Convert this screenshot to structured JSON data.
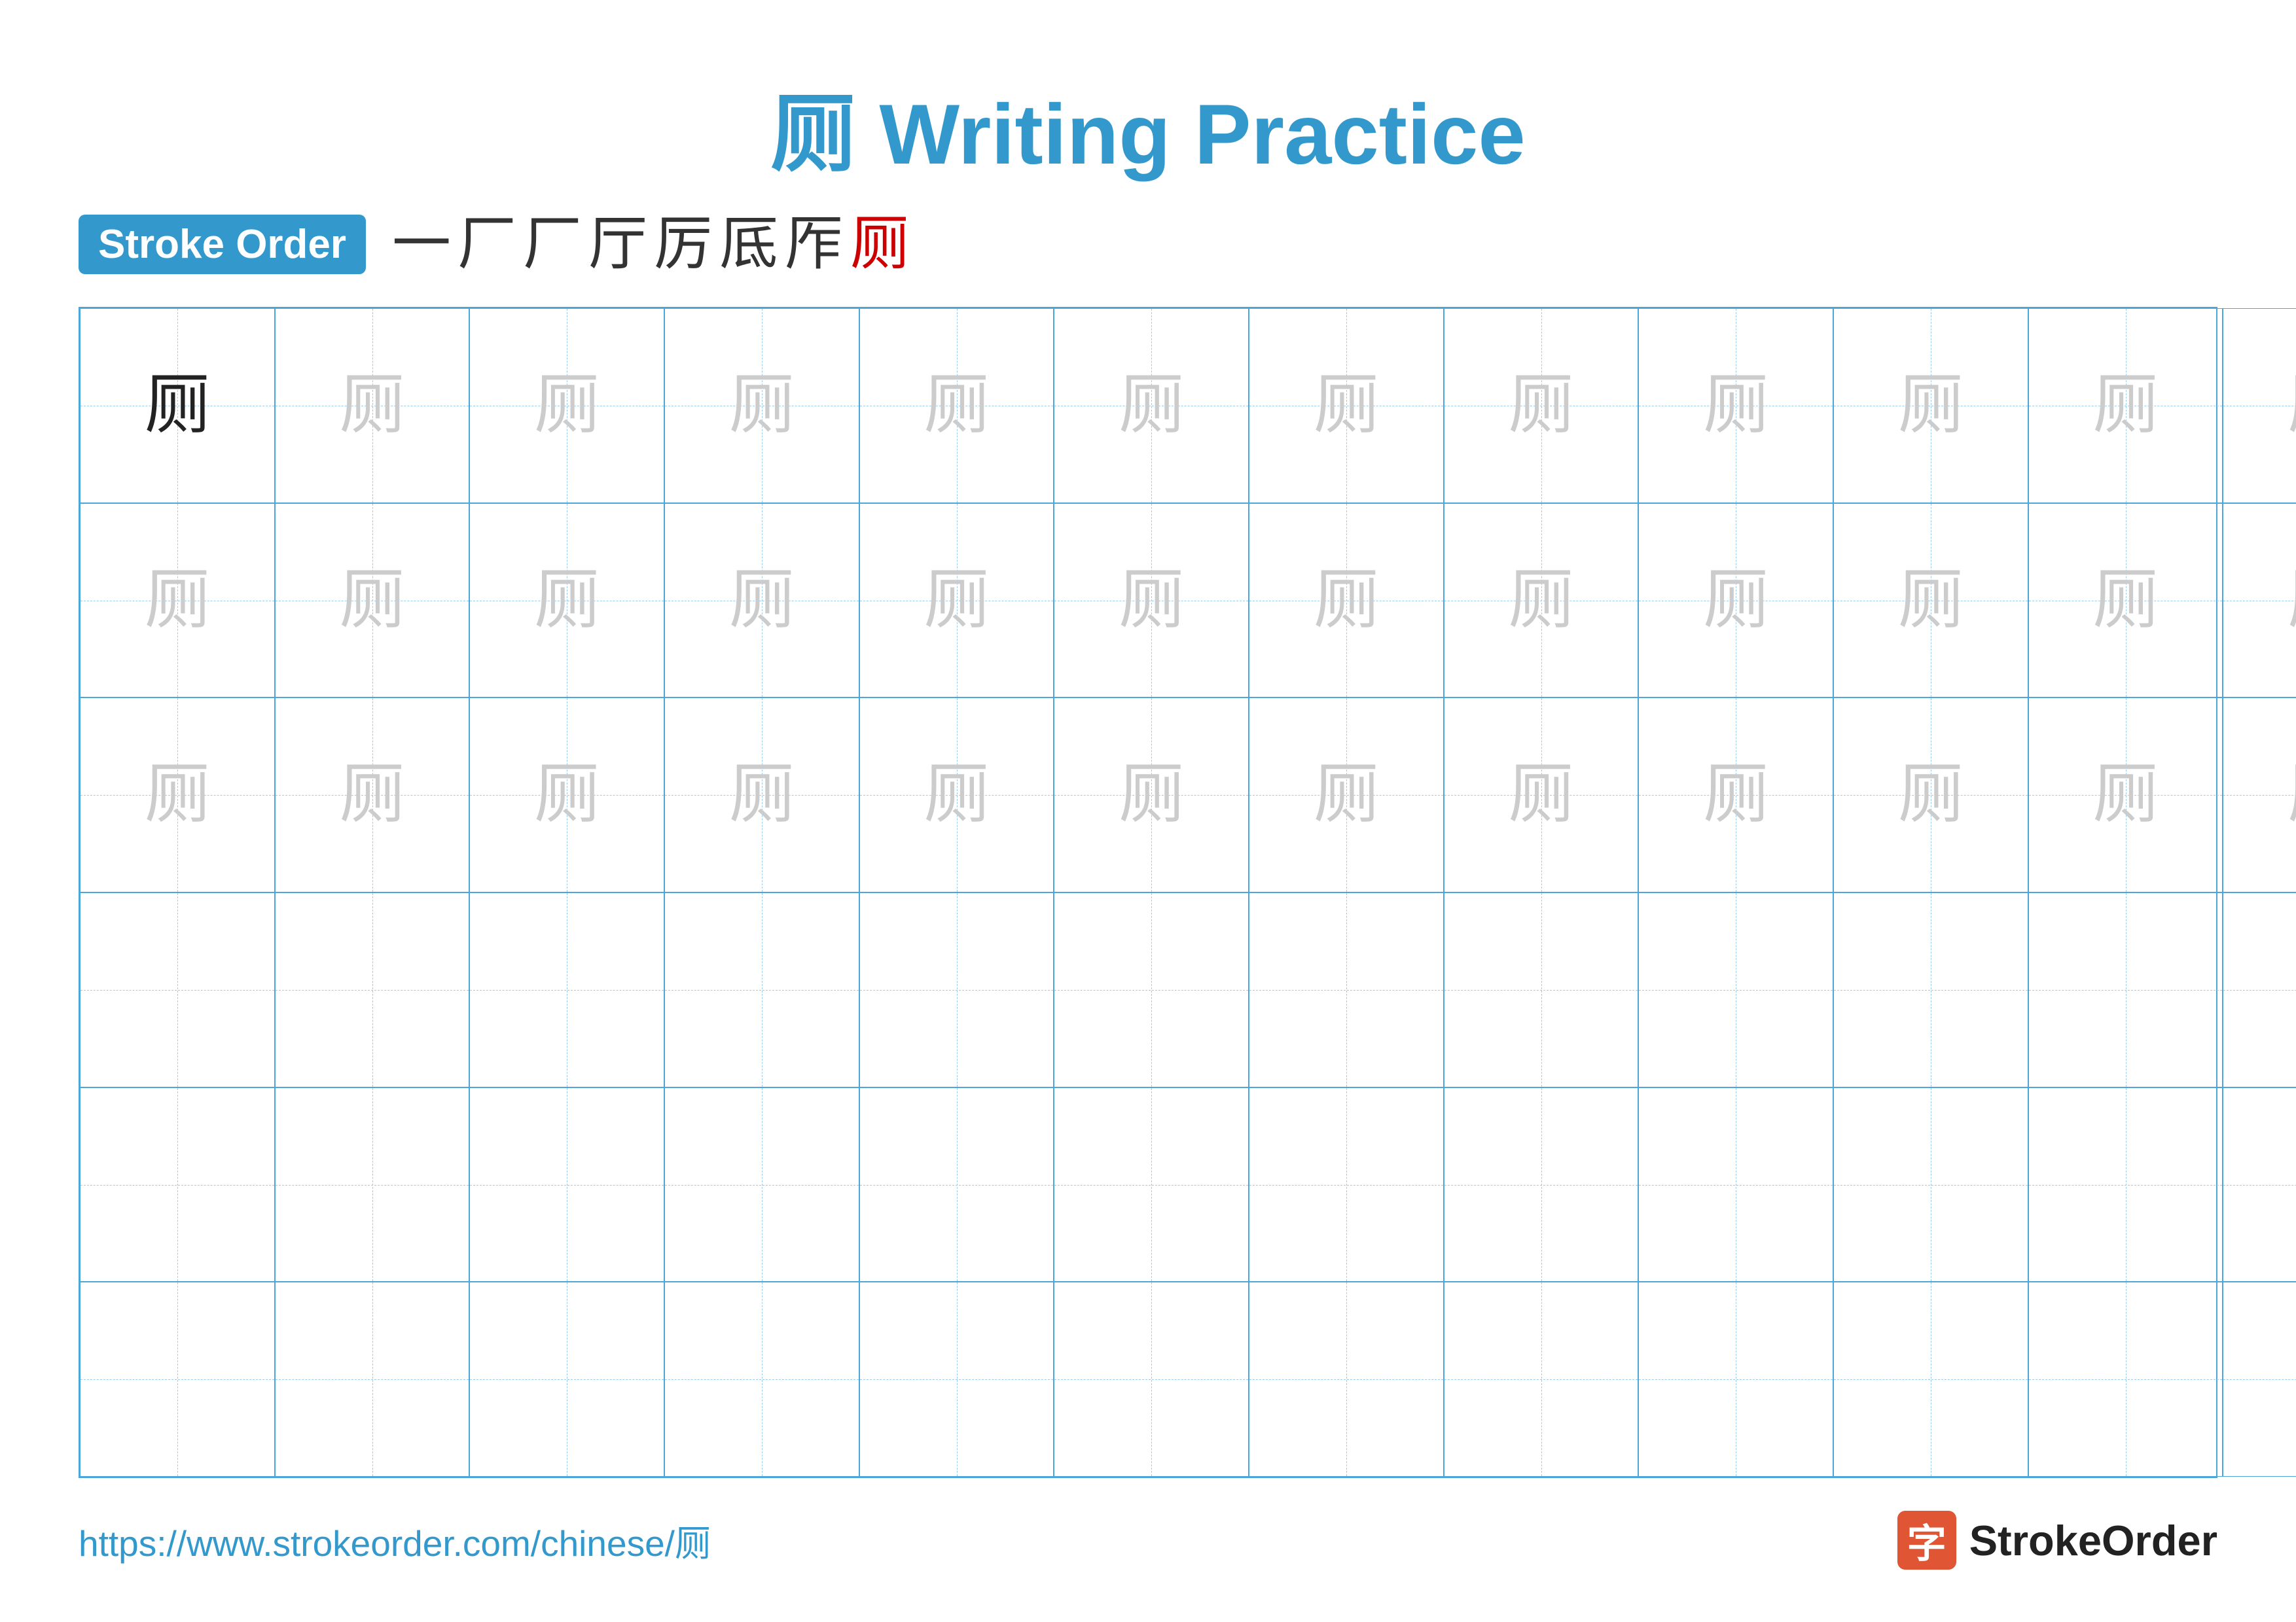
{
  "title": "厕 Writing Practice",
  "strokeOrder": {
    "badge": "Stroke Order",
    "strokes": [
      "一",
      "厂",
      "厂",
      "厅",
      "厉",
      "厎",
      "厏",
      "厕"
    ]
  },
  "character": "厕",
  "grid": {
    "rows": 6,
    "cols": 13
  },
  "footer": {
    "url": "https://www.strokeorder.com/chinese/厕",
    "logoText": "StrokeOrder",
    "logoChar": "字"
  }
}
